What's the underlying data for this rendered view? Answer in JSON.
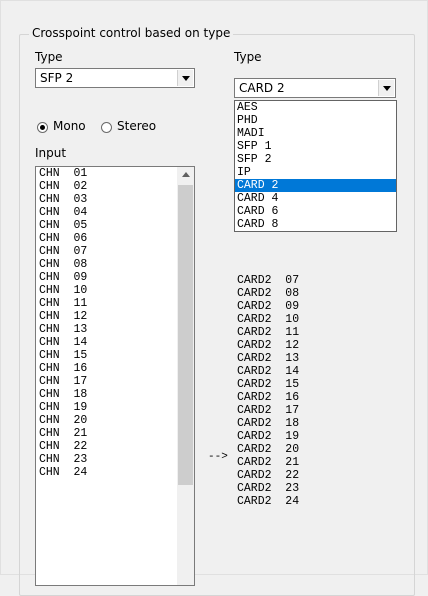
{
  "group": {
    "title": "Crosspoint control based on type"
  },
  "left": {
    "type_label": "Type",
    "type_value": "SFP 2",
    "mode": {
      "mono": "Mono",
      "stereo": "Stereo",
      "selected": "Mono"
    },
    "input_label": "Input",
    "channels": [
      "CHN  01",
      "CHN  02",
      "CHN  03",
      "CHN  04",
      "CHN  05",
      "CHN  06",
      "CHN  07",
      "CHN  08",
      "CHN  09",
      "CHN  10",
      "CHN  11",
      "CHN  12",
      "CHN  13",
      "CHN  14",
      "CHN  15",
      "CHN  16",
      "CHN  17",
      "CHN  18",
      "CHN  19",
      "CHN  20",
      "CHN  21",
      "CHN  22",
      "CHN  23",
      "CHN  24"
    ]
  },
  "right": {
    "type_label": "Type",
    "type_value": "CARD 2",
    "dropdown_options": [
      "AES",
      "PHD",
      "MADI",
      "SFP 1",
      "SFP 2",
      "IP",
      "CARD 2",
      "CARD 4",
      "CARD 6",
      "CARD 8"
    ],
    "dropdown_selected_index": 6,
    "channels": [
      "CARD2  07",
      "CARD2  08",
      "CARD2  09",
      "CARD2  10",
      "CARD2  11",
      "CARD2  12",
      "CARD2  13",
      "CARD2  14",
      "CARD2  15",
      "CARD2  16",
      "CARD2  17",
      "CARD2  18",
      "CARD2  19",
      "CARD2  20",
      "CARD2  21",
      "CARD2  22",
      "CARD2  23",
      "CARD2  24"
    ]
  },
  "arrow": "-->",
  "colors": {
    "selection": "#0078d7",
    "background": "#f0f0f0"
  }
}
